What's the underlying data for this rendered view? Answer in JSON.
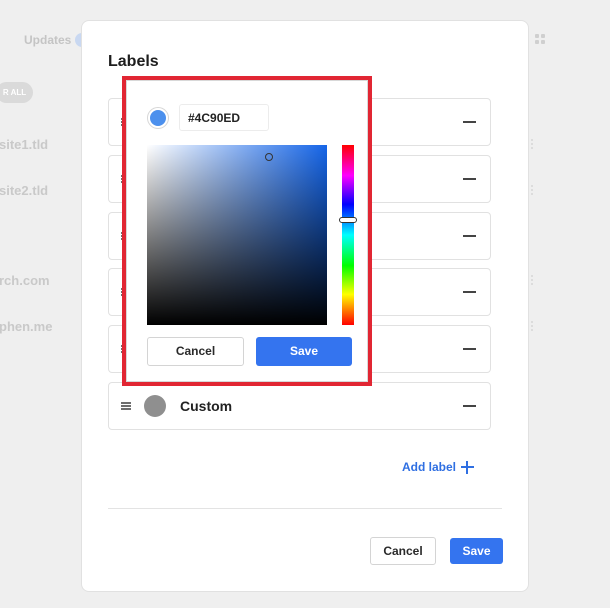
{
  "background": {
    "updates_label": "Updates",
    "pill_label": "R ALL",
    "site_items": [
      "site1.tld",
      "site2.tld",
      "rch.com",
      "phen.me"
    ]
  },
  "modal": {
    "title": "Labels",
    "labels": [
      {
        "name": "",
        "color": "#8f8f8f"
      },
      {
        "name": "",
        "color": "#8f8f8f"
      },
      {
        "name": "",
        "color": "#8f8f8f"
      },
      {
        "name": "",
        "color": "#8f8f8f"
      },
      {
        "name": "",
        "color": "#8f8f8f"
      },
      {
        "name": "Custom",
        "color": "#8f8f8f"
      }
    ],
    "add_label": "Add label",
    "cancel_label": "Cancel",
    "save_label": "Save"
  },
  "color_picker": {
    "hex_value": "#4C90ED",
    "selected_color": "#4C90ED",
    "cancel_label": "Cancel",
    "save_label": "Save"
  },
  "icons": {
    "drag": "drag-handle-icon",
    "remove": "minus-icon",
    "add": "plus-icon",
    "grid": "grid-icon",
    "more": "kebab-icon"
  },
  "colors": {
    "accent": "#3474ef",
    "highlight_border": "#e12633"
  }
}
